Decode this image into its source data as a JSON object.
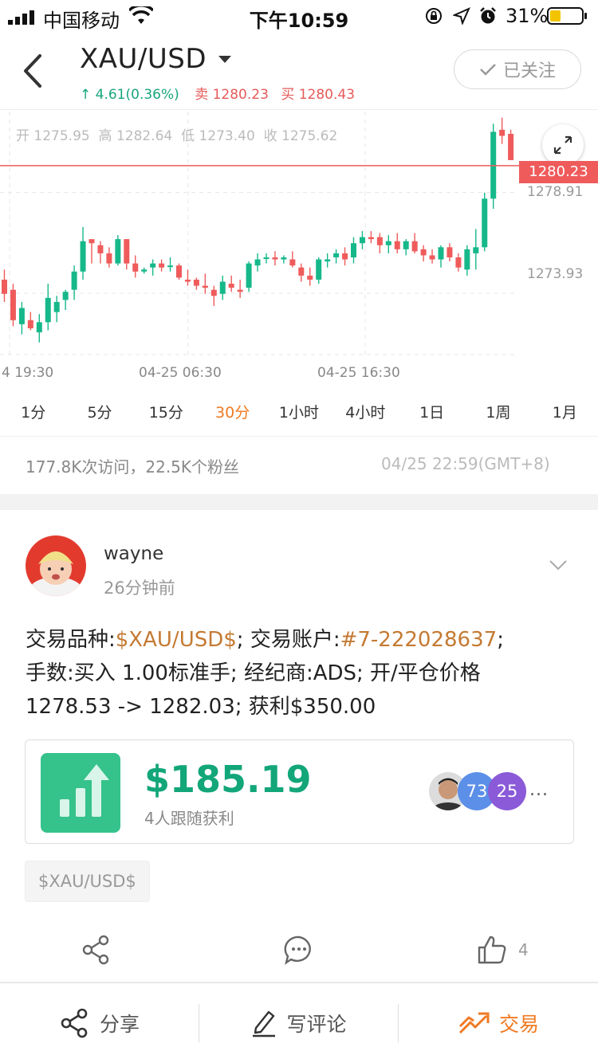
{
  "status_bar": {
    "carrier": "中国移动",
    "time": "下午10:59",
    "battery": "31%"
  },
  "header": {
    "symbol": "XAU/USD",
    "change": "↑ 4.61(0.36%)",
    "sell_label": "卖",
    "sell_price": "1280.23",
    "buy_label": "买",
    "buy_price": "1280.43",
    "follow_label": "已关注"
  },
  "chart": {
    "ohlc": {
      "open_label": "开",
      "open": "1275.95",
      "high_label": "高",
      "high": "1282.64",
      "low_label": "低",
      "low": "1273.40",
      "close_label": "收",
      "close": "1275.62"
    },
    "current_price": "1280.23",
    "y_labels": [
      "1278.91",
      "1273.93"
    ],
    "x_labels": [
      "4 19:30",
      "04-25 06:30",
      "04-25 16:30"
    ],
    "colors": {
      "up": "#16b88a",
      "down": "#ef5b5b"
    }
  },
  "chart_data": {
    "type": "candlestick",
    "ylim": [
      1270.9,
      1282.9
    ],
    "candles": [
      [
        1274.6,
        1275.1,
        1273.5,
        1273.9
      ],
      [
        1274.1,
        1274.4,
        1272.3,
        1272.6
      ],
      [
        1272.4,
        1273.5,
        1271.9,
        1273.2
      ],
      [
        1272.6,
        1273.0,
        1272.1,
        1272.2
      ],
      [
        1272.0,
        1272.9,
        1271.5,
        1272.5
      ],
      [
        1272.5,
        1274.4,
        1272.1,
        1273.7
      ],
      [
        1273.0,
        1273.8,
        1272.5,
        1273.5
      ],
      [
        1273.6,
        1274.1,
        1273.1,
        1274.0
      ],
      [
        1274.1,
        1275.3,
        1273.6,
        1275.0
      ],
      [
        1275.0,
        1277.2,
        1274.6,
        1276.5
      ],
      [
        1276.6,
        1276.5,
        1275.4,
        1276.4
      ],
      [
        1276.3,
        1276.5,
        1275.4,
        1275.9
      ],
      [
        1275.9,
        1276.2,
        1275.2,
        1275.4
      ],
      [
        1275.4,
        1276.8,
        1275.3,
        1276.6
      ],
      [
        1276.6,
        1276.6,
        1275.1,
        1275.4
      ],
      [
        1275.4,
        1275.8,
        1274.7,
        1275.0
      ],
      [
        1275.0,
        1275.2,
        1274.9,
        1275.1
      ],
      [
        1275.2,
        1275.6,
        1274.8,
        1275.4
      ],
      [
        1275.4,
        1275.6,
        1275.0,
        1275.2
      ],
      [
        1275.3,
        1275.7,
        1275.0,
        1275.3
      ],
      [
        1275.3,
        1275.4,
        1274.6,
        1274.7
      ],
      [
        1274.6,
        1275.1,
        1274.3,
        1274.5
      ],
      [
        1274.6,
        1274.7,
        1274.1,
        1274.3
      ],
      [
        1274.3,
        1274.9,
        1273.9,
        1274.2
      ],
      [
        1274.1,
        1274.3,
        1273.3,
        1273.8
      ],
      [
        1273.9,
        1274.8,
        1273.6,
        1274.5
      ],
      [
        1274.4,
        1274.8,
        1274.0,
        1274.2
      ],
      [
        1274.1,
        1274.6,
        1273.7,
        1274.0
      ],
      [
        1274.2,
        1275.5,
        1274.0,
        1275.4
      ],
      [
        1275.3,
        1275.9,
        1275.0,
        1275.6
      ],
      [
        1275.7,
        1275.9,
        1275.4,
        1275.7
      ],
      [
        1275.7,
        1276.0,
        1275.3,
        1275.6
      ],
      [
        1275.6,
        1275.8,
        1275.4,
        1275.7
      ],
      [
        1275.6,
        1276.0,
        1275.2,
        1275.3
      ],
      [
        1275.2,
        1275.4,
        1274.5,
        1274.8
      ],
      [
        1274.8,
        1275.2,
        1274.3,
        1274.6
      ],
      [
        1274.6,
        1275.7,
        1274.4,
        1275.6
      ],
      [
        1275.5,
        1275.9,
        1275.2,
        1275.6
      ],
      [
        1275.7,
        1276.1,
        1275.4,
        1275.9
      ],
      [
        1275.9,
        1276.2,
        1275.3,
        1275.6
      ],
      [
        1275.7,
        1276.7,
        1275.4,
        1276.4
      ],
      [
        1276.4,
        1277.0,
        1276.1,
        1276.7
      ],
      [
        1276.7,
        1277.0,
        1276.4,
        1276.6
      ],
      [
        1276.7,
        1276.9,
        1275.9,
        1276.3
      ],
      [
        1276.3,
        1276.8,
        1275.9,
        1276.5
      ],
      [
        1276.5,
        1276.9,
        1275.9,
        1276.1
      ],
      [
        1276.1,
        1276.6,
        1275.8,
        1276.5
      ],
      [
        1276.5,
        1276.9,
        1275.9,
        1276.0
      ],
      [
        1276.1,
        1276.3,
        1275.5,
        1275.8
      ],
      [
        1275.8,
        1276.1,
        1275.4,
        1275.6
      ],
      [
        1275.6,
        1276.3,
        1275.2,
        1276.2
      ],
      [
        1276.2,
        1276.4,
        1275.5,
        1275.7
      ],
      [
        1275.7,
        1275.9,
        1275.0,
        1275.2
      ],
      [
        1275.1,
        1276.3,
        1274.8,
        1276.1
      ],
      [
        1275.9,
        1277.1,
        1275.1,
        1276.2
      ],
      [
        1276.2,
        1278.9,
        1276.0,
        1278.6
      ],
      [
        1278.6,
        1282.3,
        1278.1,
        1281.9
      ],
      [
        1282.0,
        1282.6,
        1281.3,
        1281.7
      ],
      [
        1281.8,
        1282.0,
        1280.7,
        1280.5
      ]
    ]
  },
  "periods": [
    "1分",
    "5分",
    "15分",
    "30分",
    "1小时",
    "4小时",
    "1日",
    "1周",
    "1月"
  ],
  "active_period": "30分",
  "stats": {
    "visits": "177.8K次访问，22.5K个粉丝",
    "datetime": "04/25 22:59(GMT+8)"
  },
  "post": {
    "username": "wayne",
    "time": "26分钟前",
    "content": {
      "p1_label": "交易品种:",
      "p1_value": "$XAU/USD$",
      "p2_label": "; 交易账户:",
      "p2_value": "#7-222028637",
      "p3": ";\n手数:买入 1.00标准手; 经纪商:ADS; 开/平仓价格\n1278.53 -> 1282.03; 获利$350.00"
    },
    "card": {
      "amount": "$185.19",
      "label": "4人跟随获利",
      "badge1": "73",
      "badge2": "25",
      "more": "...",
      "badge1_color": "#5b8fe8",
      "badge2_color": "#8a5ad8"
    },
    "tag": "$XAU/USD$",
    "like_count": "4"
  },
  "bottom_bar": {
    "share": "分享",
    "comment": "写评论",
    "trade": "交易"
  }
}
